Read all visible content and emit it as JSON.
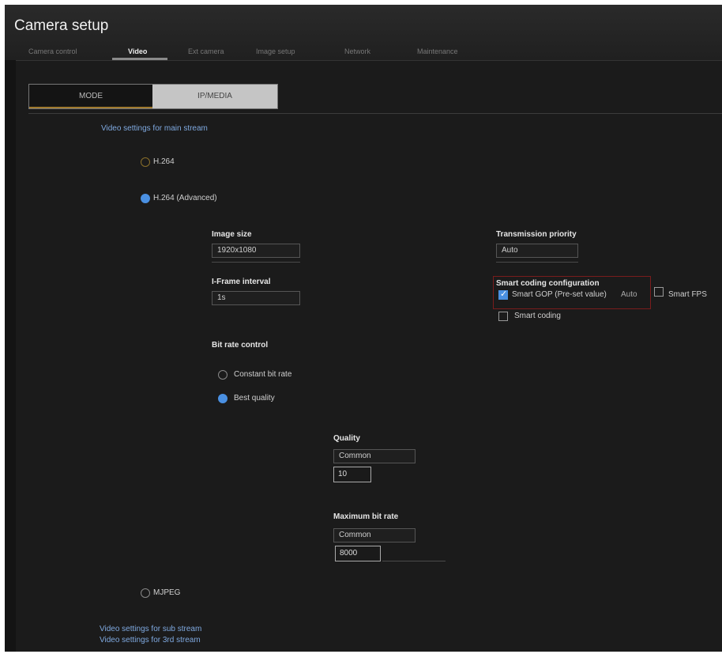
{
  "header": {
    "title": "Camera setup",
    "tabs": [
      {
        "label": "Camera control",
        "active": false
      },
      {
        "label": "Video",
        "active": true
      },
      {
        "label": "Ext camera",
        "active": false
      },
      {
        "label": "Image setup",
        "active": false
      },
      {
        "label": "Network",
        "active": false
      },
      {
        "label": "Maintenance",
        "active": false
      }
    ]
  },
  "mode": {
    "options": [
      "MODE",
      "IP/MEDIA"
    ],
    "selected": "MODE"
  },
  "links": {
    "top": "Video settings for main stream",
    "bottom_1": "Video settings for sub stream",
    "bottom_2": "Video settings for 3rd stream"
  },
  "stream_mode": {
    "options": [
      {
        "label": "H.264",
        "state": "off"
      },
      {
        "label": "H.264 (Advanced)",
        "state": "on"
      },
      {
        "label": "MJPEG",
        "state": "off"
      }
    ]
  },
  "settings": {
    "image_size": {
      "label": "Image size",
      "value": "1920x1080"
    },
    "refresh_interval": {
      "label": "I-Frame interval",
      "value": "1s"
    },
    "bit_rate_control": {
      "label": "Bit rate control"
    },
    "bit_rate_options": [
      {
        "label": "Constant bit rate",
        "state": "off"
      },
      {
        "label": "Best quality",
        "state": "on"
      }
    ],
    "quality": {
      "label": "Quality",
      "select_value": "Common",
      "input_value": "10"
    },
    "max_bit_rate": {
      "label": "Maximum bit rate",
      "select_value": "Common",
      "input_value": "8000"
    },
    "transmission_priority": {
      "label": "Transmission priority",
      "value": "Auto"
    },
    "smart_coding": {
      "label": "Smart coding configuration",
      "option_gop": {
        "label": "Smart GOP (Pre-set value)",
        "extra": "Auto",
        "checked": true
      },
      "option_fps": {
        "label": "Smart FPS",
        "checked": false
      },
      "option_smart_coding": {
        "label": "Smart coding",
        "checked": false
      }
    }
  },
  "colors": {
    "background": "#1b1b1b",
    "accent_blue": "#4a90e2",
    "link": "#7fa9e0",
    "highlight_border": "#7a1c1c"
  }
}
